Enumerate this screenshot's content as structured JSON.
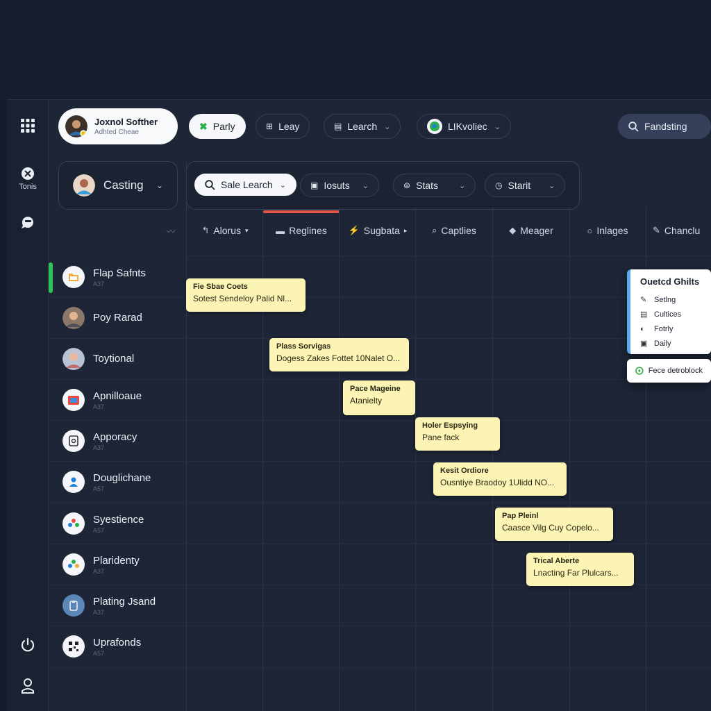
{
  "profile": {
    "name": "Joxnol Softher",
    "subtitle": "Adhted Cheae"
  },
  "toolbar": {
    "party": "Parly",
    "lazy": "Leay",
    "search": "Learch",
    "workspace": "LIKvoliec",
    "find": "Fandsting"
  },
  "rail": {
    "tools_label": "Tonis"
  },
  "left_filter": {
    "label": "Casting"
  },
  "filters": {
    "sale_search": "Sale Learch",
    "issues": "Iosuts",
    "stats": "Stats",
    "start": "Starit"
  },
  "columns": [
    {
      "label": "Alorus",
      "icon": "↰"
    },
    {
      "label": "Reglines",
      "icon": "▬"
    },
    {
      "label": "Sugbata",
      "icon": "⚡"
    },
    {
      "label": "Captlies",
      "icon": "⌕"
    },
    {
      "label": "Meager",
      "icon": "◆"
    },
    {
      "label": "Inlages",
      "icon": "○"
    },
    {
      "label": "Chanclu",
      "icon": "✎"
    }
  ],
  "rows": [
    {
      "name": "Flap Safnts",
      "sub": "A37",
      "icon": "folder-icon"
    },
    {
      "name": "Poy Rarad",
      "sub": "",
      "icon": "user-avatar"
    },
    {
      "name": "Toytional",
      "sub": "",
      "icon": "user-avatar"
    },
    {
      "name": "Apnilloaue",
      "sub": "A37",
      "icon": "image-icon"
    },
    {
      "name": "Apporacy",
      "sub": "A37",
      "icon": "document-icon"
    },
    {
      "name": "Douglichane",
      "sub": "A57",
      "icon": "people-icon"
    },
    {
      "name": "Syestience",
      "sub": "A57",
      "icon": "people-icon"
    },
    {
      "name": "Plaridenty",
      "sub": "A37",
      "icon": "people-icon"
    },
    {
      "name": "Plating Jsand",
      "sub": "A37",
      "icon": "clipboard-icon"
    },
    {
      "name": "Uprafonds",
      "sub": "A57",
      "icon": "qr-icon"
    }
  ],
  "cards": [
    {
      "title": "Fie Sbae Coets",
      "sub": "Sotest Sendeloy Palid Nl..."
    },
    {
      "title": "Plass Sorvigas",
      "sub": "Dogess Zakes Fottet 10Nalet O..."
    },
    {
      "title": "Pace Mageine",
      "sub": "Atanielty"
    },
    {
      "title": "Holer Espsying",
      "sub": "Pane fack"
    },
    {
      "title": "Kesit Ordiore",
      "sub": "Ousntiye Braodoy 1Ulidd NO..."
    },
    {
      "title": "Pap Pleinl",
      "sub": "Caasce Vilg Cuy Copelo..."
    },
    {
      "title": "Trical Aberte",
      "sub": "Lnacting Far Plulcars..."
    }
  ],
  "popup": {
    "title": "Ouetcd Ghilts",
    "items": [
      {
        "label": "Setlng",
        "icon": "✎"
      },
      {
        "label": "Cultices",
        "icon": "▤"
      },
      {
        "label": "Fotrly",
        "icon": "◐"
      },
      {
        "label": "Daily",
        "icon": "▣"
      }
    ],
    "footer": "Fece detroblock"
  },
  "colors": {
    "background": "#1d2536",
    "card": "#fbf4b4",
    "active_row": "#2ec05a",
    "active_column": "#e2574c"
  }
}
